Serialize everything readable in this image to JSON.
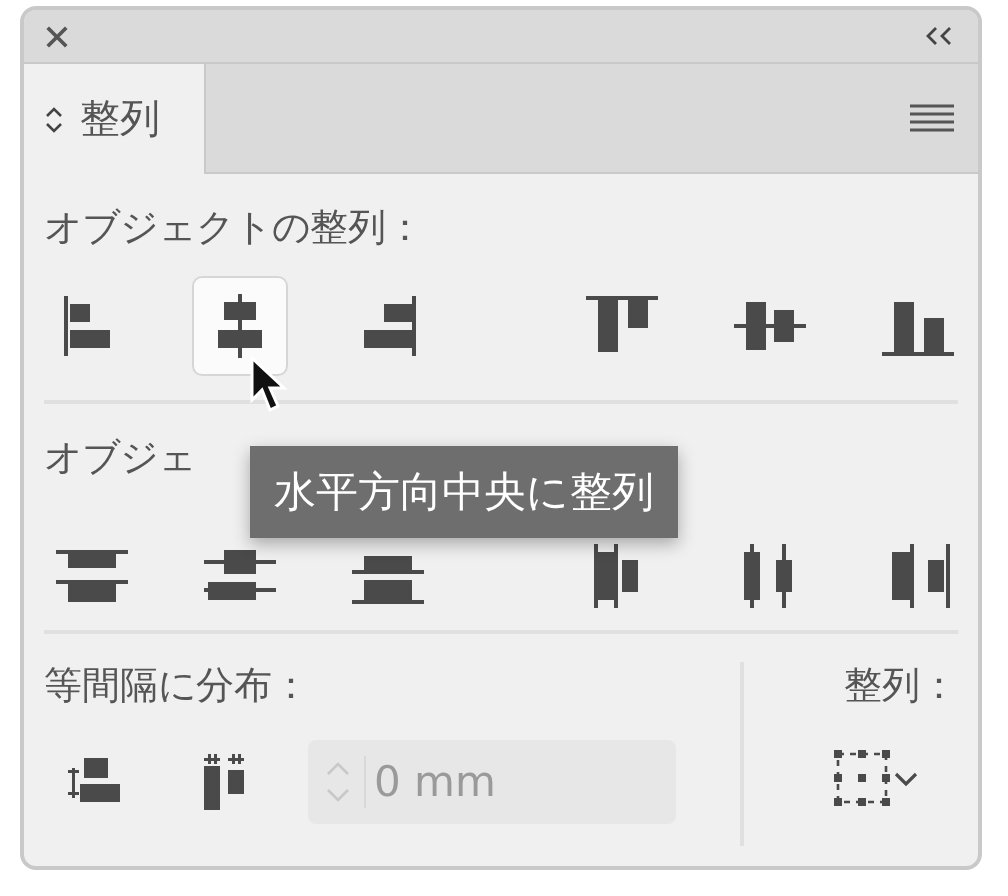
{
  "panel": {
    "tab": {
      "label": "整列",
      "selected": true
    }
  },
  "sections": [
    {
      "label": "オブジェクトの整列：",
      "buttons": [
        {
          "kind": "align-left",
          "hovered": false
        },
        {
          "kind": "align-hcenter",
          "hovered": true
        },
        {
          "kind": "align-right",
          "hovered": false
        },
        {
          "kind": "align-top",
          "hovered": false
        },
        {
          "kind": "align-vcenter",
          "hovered": false
        },
        {
          "kind": "align-bottom",
          "hovered": false
        }
      ]
    },
    {
      "label": "オブジェ",
      "buttons": [
        {
          "kind": "dist-top",
          "hovered": false
        },
        {
          "kind": "dist-vcenter",
          "hovered": false
        },
        {
          "kind": "dist-bottom",
          "hovered": false
        },
        {
          "kind": "dist-left",
          "hovered": false
        },
        {
          "kind": "dist-hcenter",
          "hovered": false
        },
        {
          "kind": "dist-right",
          "hovered": false
        }
      ]
    }
  ],
  "spacing": {
    "label": "等間隔に分布：",
    "buttons": [
      {
        "kind": "space-vertical",
        "hovered": false
      },
      {
        "kind": "space-horizontal",
        "hovered": false
      }
    ],
    "field": {
      "value": "0 mm",
      "disabled": true
    }
  },
  "align_to": {
    "label": "整列：",
    "button": {
      "kind": "align-to"
    }
  },
  "tooltip": {
    "text": "水平方向中央に整列"
  }
}
